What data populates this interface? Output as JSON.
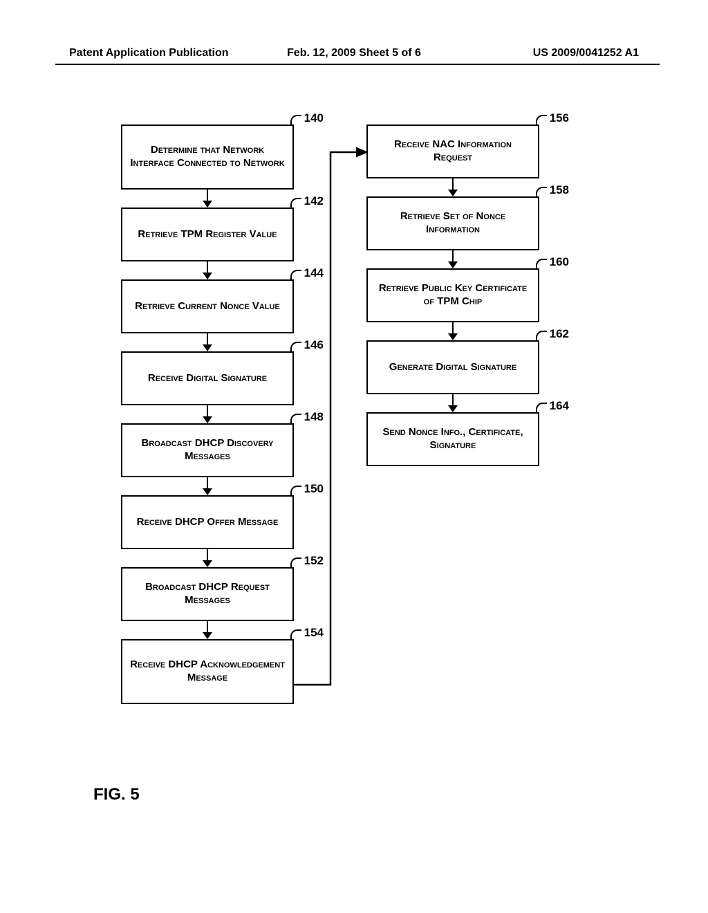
{
  "header": {
    "left": "Patent Application Publication",
    "center": "Feb. 12, 2009  Sheet 5 of 6",
    "right": "US 2009/0041252 A1"
  },
  "left_column": [
    {
      "num": "140",
      "text": "Determine that Network Interface Connected to Network",
      "tall": true
    },
    {
      "num": "142",
      "text": "Retrieve TPM Register Value"
    },
    {
      "num": "144",
      "text": "Retrieve Current Nonce Value"
    },
    {
      "num": "146",
      "text": "Receive Digital Signature"
    },
    {
      "num": "148",
      "text": "Broadcast DHCP Discovery Messages"
    },
    {
      "num": "150",
      "text": "Receive DHCP Offer Message"
    },
    {
      "num": "152",
      "text": "Broadcast DHCP Request Messages"
    },
    {
      "num": "154",
      "text": "Receive DHCP Acknowledgement Message",
      "tall": true
    }
  ],
  "right_column": [
    {
      "num": "156",
      "text": "Receive NAC Information Request"
    },
    {
      "num": "158",
      "text": "Retrieve Set of Nonce Information"
    },
    {
      "num": "160",
      "text": "Retrieve Public Key Certificate of TPM Chip"
    },
    {
      "num": "162",
      "text": "Generate Digital Signature"
    },
    {
      "num": "164",
      "text": "Send Nonce Info., Certificate, Signature"
    }
  ],
  "figure_label": "FIG. 5"
}
